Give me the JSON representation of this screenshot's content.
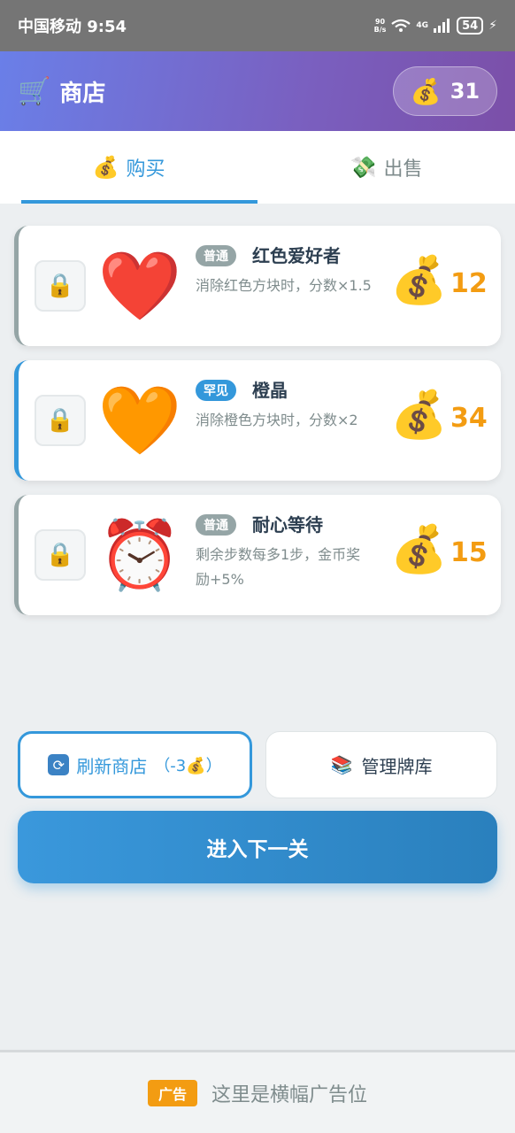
{
  "status_bar": {
    "carrier_time": "中国移动 9:54",
    "net_speed_top": "90",
    "net_speed_bottom": "B/s",
    "network": "4G",
    "battery": "54"
  },
  "header": {
    "title": "商店",
    "cart_icon": "🛒",
    "coin_icon": "💰",
    "coins": "31"
  },
  "tabs": [
    {
      "label": "购买",
      "icon": "💰",
      "active": true
    },
    {
      "label": "出售",
      "icon": "💸",
      "active": false
    }
  ],
  "items": [
    {
      "emoji": "❤️",
      "rarity": "普通",
      "name": "红色爱好者",
      "desc": "消除红色方块时，分数×1.5",
      "price": "12",
      "price_icon": "💰",
      "lock_icon": "🔒"
    },
    {
      "emoji": "🧡",
      "rarity": "罕见",
      "name": "橙晶",
      "desc": "消除橙色方块时，分数×2",
      "price": "34",
      "price_icon": "💰",
      "lock_icon": "🔒"
    },
    {
      "emoji": "⏰",
      "rarity": "普通",
      "name": "耐心等待",
      "desc": "剩余步数每多1步，金币奖励+5%",
      "price": "15",
      "price_icon": "💰",
      "lock_icon": "🔒"
    }
  ],
  "actions": {
    "refresh_label": "刷新商店",
    "refresh_cost": "（-3💰）",
    "manage_icon": "📚",
    "manage_label": "管理牌库",
    "next_label": "进入下一关"
  },
  "ad": {
    "tag": "广告",
    "text": "这里是横幅广告位"
  },
  "colors": {
    "accent": "#3498db",
    "price": "#f39c12",
    "common": "#95a5a6"
  }
}
